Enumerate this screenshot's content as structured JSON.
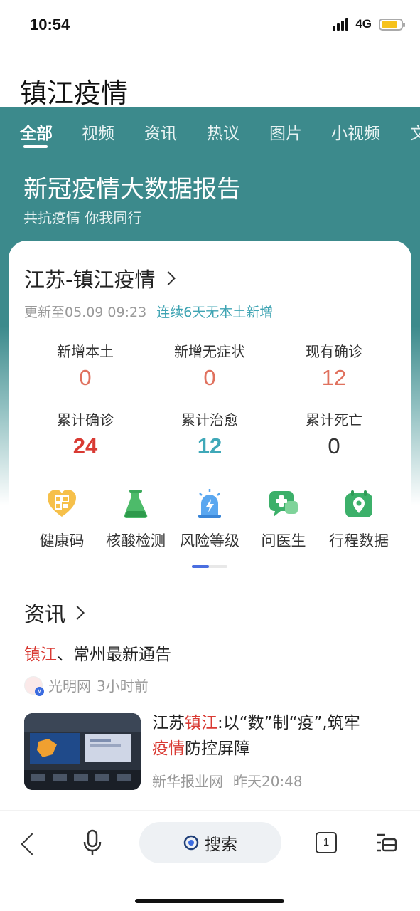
{
  "status_bar": {
    "time": "10:54",
    "network": "4G"
  },
  "search": {
    "query_title": "镇江疫情"
  },
  "tabs": [
    {
      "label": "全部",
      "active": true
    },
    {
      "label": "视频"
    },
    {
      "label": "资讯"
    },
    {
      "label": "热议"
    },
    {
      "label": "图片"
    },
    {
      "label": "小视频"
    },
    {
      "label": "文"
    }
  ],
  "banner": {
    "title": "新冠疫情大数据报告",
    "subtitle": "共抗疫情 你我同行"
  },
  "card": {
    "region_title": "江苏-镇江疫情",
    "update_time": "更新至05.09 09:23",
    "streak_text": "连续6天无本土新增",
    "stats": [
      {
        "label": "新增本土",
        "value": "0"
      },
      {
        "label": "新增无症状",
        "value": "0"
      },
      {
        "label": "现有确诊",
        "value": "12"
      },
      {
        "label": "累计确诊",
        "value": "24"
      },
      {
        "label": "累计治愈",
        "value": "12"
      },
      {
        "label": "累计死亡",
        "value": "0"
      }
    ],
    "shortcuts": [
      {
        "label": "健康码",
        "icon": "health-code-icon"
      },
      {
        "label": "核酸检测",
        "icon": "flask-icon"
      },
      {
        "label": "风险等级",
        "icon": "alarm-light-icon"
      },
      {
        "label": "问医生",
        "icon": "doctor-chat-icon"
      },
      {
        "label": "行程数据",
        "icon": "location-pin-icon"
      }
    ],
    "news_header": "资讯",
    "news": [
      {
        "title_highlight": "镇江",
        "title_rest": "、常州最新通告",
        "source": "光明网",
        "time": "3小时前"
      },
      {
        "title_pre": "江苏",
        "title_hl1": "镇江",
        "title_mid": ":以“数”制“疫”,筑牢",
        "title_hl2": "疫情",
        "title_post": "防控屏障",
        "source": "新华报业网",
        "time": "昨天20:48"
      }
    ]
  },
  "bottom_bar": {
    "search_label": "搜索",
    "tab_count": "1"
  },
  "colors": {
    "teal": "#3c8a8c",
    "highlight_red": "#d93a33",
    "accent_blue": "#4a6ee0"
  }
}
